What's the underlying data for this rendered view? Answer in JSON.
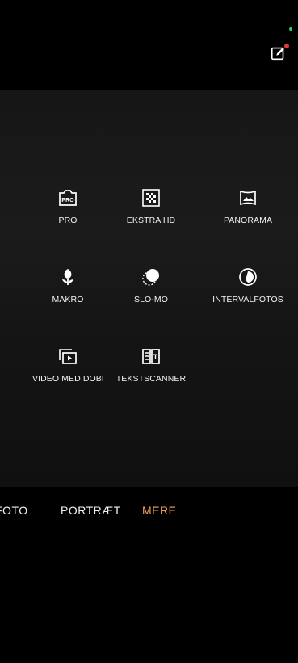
{
  "header": {
    "edit_icon": "edit-pencil-icon",
    "badge_color": "#e53935",
    "status_dot_color": "#2ecc71"
  },
  "modes": [
    {
      "label": "PRO",
      "icon": "pro-camera-icon"
    },
    {
      "label": "EKSTRA HD",
      "icon": "hd-grid-icon"
    },
    {
      "label": "PANORAMA",
      "icon": "panorama-icon"
    },
    {
      "label": "MAKRO",
      "icon": "macro-flower-icon"
    },
    {
      "label": "SLO-MO",
      "icon": "slow-motion-icon"
    },
    {
      "label": "INTERVALFOTOS",
      "icon": "timelapse-icon"
    },
    {
      "label": "VIDEO MED DOBBELT",
      "icon": "dual-video-icon"
    },
    {
      "label": "TEKSTSCANNER",
      "icon": "text-scanner-icon"
    }
  ],
  "mode_tabs": [
    {
      "label": "FOTO"
    },
    {
      "label": "PORTRÆT"
    },
    {
      "label": "MERE",
      "active": true
    }
  ],
  "colors": {
    "active_tab": "#f0a35a",
    "background": "#000000",
    "panel": "#1a1a1a"
  }
}
